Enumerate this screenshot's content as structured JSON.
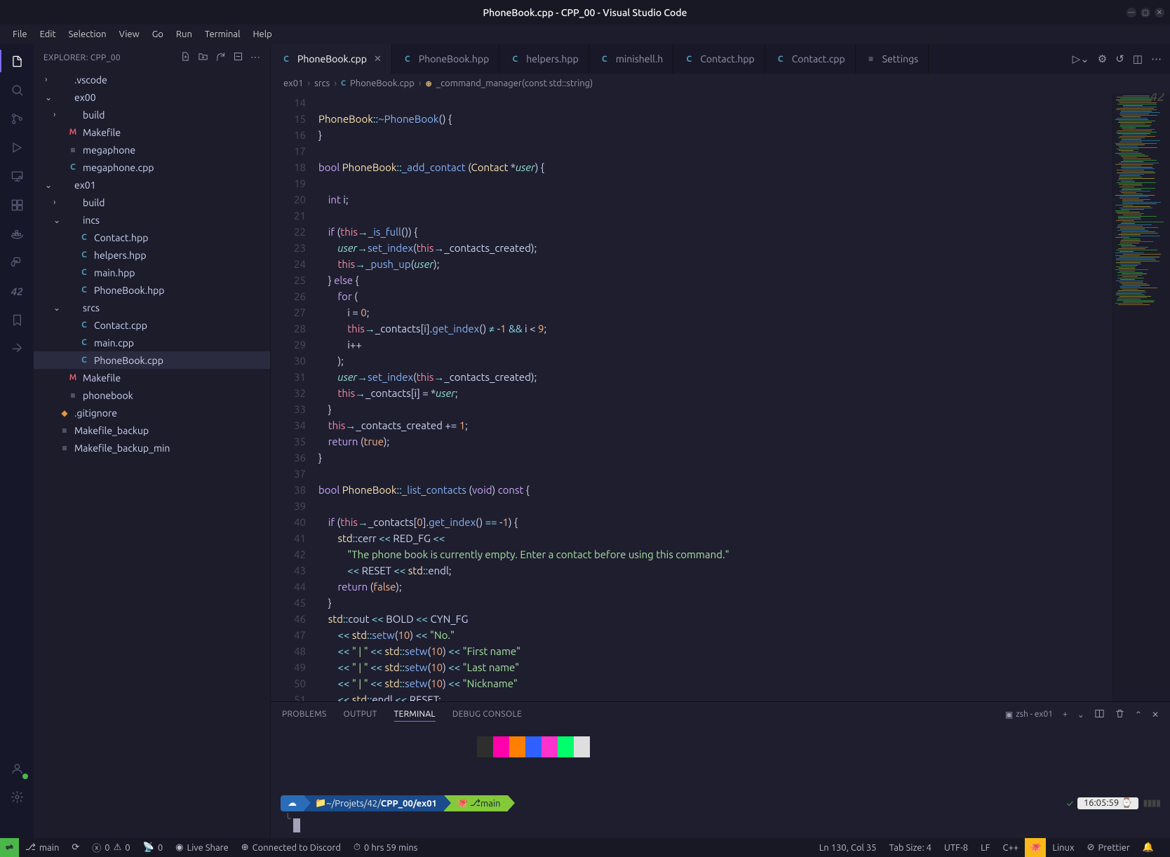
{
  "window": {
    "title": "PhoneBook.cpp - CPP_00 - Visual Studio Code"
  },
  "menubar": [
    "File",
    "Edit",
    "Selection",
    "View",
    "Go",
    "Run",
    "Terminal",
    "Help"
  ],
  "sidebar": {
    "title": "EXPLORER: CPP_00",
    "items": [
      {
        "indent": 0,
        "chev": "›",
        "icon": "",
        "label": ".vscode"
      },
      {
        "indent": 0,
        "chev": "⌄",
        "icon": "",
        "label": "ex00"
      },
      {
        "indent": 1,
        "chev": "›",
        "icon": "",
        "label": "build"
      },
      {
        "indent": 1,
        "chev": "",
        "icon": "M",
        "label": "Makefile"
      },
      {
        "indent": 1,
        "chev": "",
        "icon": "≡",
        "label": "megaphone",
        "iconcls": "txt"
      },
      {
        "indent": 1,
        "chev": "",
        "icon": "C",
        "label": "megaphone.cpp"
      },
      {
        "indent": 0,
        "chev": "⌄",
        "icon": "",
        "label": "ex01"
      },
      {
        "indent": 1,
        "chev": "›",
        "icon": "",
        "label": "build"
      },
      {
        "indent": 1,
        "chev": "⌄",
        "icon": "",
        "label": "incs"
      },
      {
        "indent": 2,
        "chev": "",
        "icon": "C",
        "label": "Contact.hpp"
      },
      {
        "indent": 2,
        "chev": "",
        "icon": "C",
        "label": "helpers.hpp"
      },
      {
        "indent": 2,
        "chev": "",
        "icon": "C",
        "label": "main.hpp"
      },
      {
        "indent": 2,
        "chev": "",
        "icon": "C",
        "label": "PhoneBook.hpp"
      },
      {
        "indent": 1,
        "chev": "⌄",
        "icon": "",
        "label": "srcs"
      },
      {
        "indent": 2,
        "chev": "",
        "icon": "C",
        "label": "Contact.cpp"
      },
      {
        "indent": 2,
        "chev": "",
        "icon": "C",
        "label": "main.cpp"
      },
      {
        "indent": 2,
        "chev": "",
        "icon": "C",
        "label": "PhoneBook.cpp",
        "active": true
      },
      {
        "indent": 1,
        "chev": "",
        "icon": "M",
        "label": "Makefile"
      },
      {
        "indent": 1,
        "chev": "",
        "icon": "≡",
        "label": "phonebook",
        "iconcls": "txt"
      },
      {
        "indent": 0,
        "chev": "",
        "icon": "◆",
        "label": ".gitignore",
        "iconcls": "git"
      },
      {
        "indent": 0,
        "chev": "",
        "icon": "≡",
        "label": "Makefile_backup",
        "iconcls": "txt"
      },
      {
        "indent": 0,
        "chev": "",
        "icon": "≡",
        "label": "Makefile_backup_min",
        "iconcls": "txt"
      }
    ]
  },
  "tabs": [
    {
      "icon": "C",
      "label": "PhoneBook.cpp",
      "active": true,
      "close": true
    },
    {
      "icon": "C",
      "label": "PhoneBook.hpp"
    },
    {
      "icon": "C",
      "label": "helpers.hpp"
    },
    {
      "icon": "C",
      "label": "minishell.h"
    },
    {
      "icon": "C",
      "label": "Contact.hpp"
    },
    {
      "icon": "C",
      "label": "Contact.cpp"
    },
    {
      "icon": "≡",
      "label": "Settings",
      "iconcls": "txt"
    }
  ],
  "breadcrumb": [
    "ex01",
    "srcs",
    "PhoneBook.cpp",
    "_command_manager(const std::string)"
  ],
  "lines": [
    14,
    15,
    16,
    17,
    18,
    19,
    20,
    21,
    22,
    23,
    24,
    25,
    26,
    27,
    28,
    29,
    30,
    31,
    32,
    33,
    34,
    35,
    36,
    37,
    38,
    39,
    40,
    41,
    42,
    43,
    44,
    45,
    46,
    47,
    48,
    49,
    50,
    51
  ],
  "panel": {
    "tabs": [
      "PROBLEMS",
      "OUTPUT",
      "TERMINAL",
      "DEBUG CONSOLE"
    ],
    "active": "TERMINAL",
    "shell": "zsh - ex01",
    "swatches": [
      "#2e2e2e",
      "#ff00ab",
      "#ff8000",
      "#3060ff",
      "#ff33cc",
      "#00ff6a",
      "#dedede"
    ],
    "prompt": {
      "path": "~/Projets/42/CPP_00/ex01",
      "branch": "main",
      "time": "16:05:59"
    }
  },
  "status": {
    "branch": "main",
    "errors": "0",
    "warnings": "0",
    "ports": "0",
    "liveshare": "Live Share",
    "discord": "Connected to Discord",
    "timer": "0 hrs 59 mins",
    "pos": "Ln 130, Col 35",
    "tab": "Tab Size: 4",
    "enc": "UTF-8",
    "eol": "LF",
    "lang": "C++",
    "linux": "Linux",
    "prettier": "Prettier"
  }
}
